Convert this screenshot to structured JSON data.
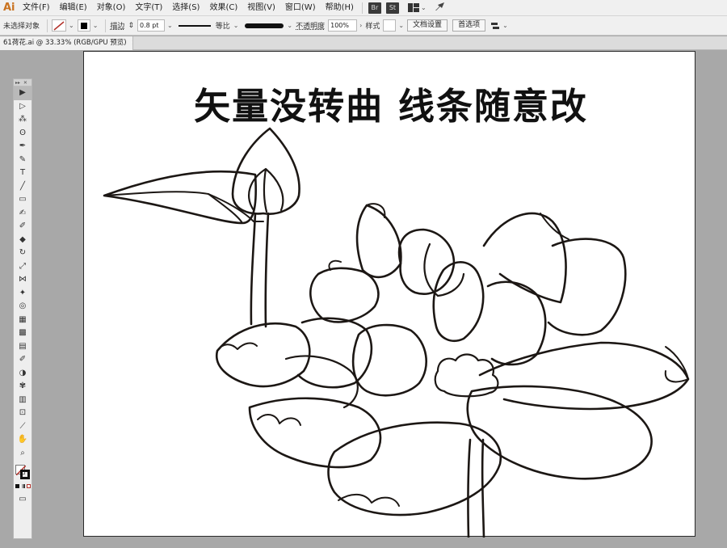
{
  "app": {
    "logo": "Ai"
  },
  "menu": {
    "items": [
      "文件(F)",
      "编辑(E)",
      "对象(O)",
      "文字(T)",
      "选择(S)",
      "效果(C)",
      "视图(V)",
      "窗口(W)",
      "帮助(H)"
    ],
    "badges": [
      "Br",
      "St"
    ]
  },
  "control_bar": {
    "selection_status": "未选择对象",
    "stroke_label": "描边",
    "stroke_weight": "0.8 pt",
    "profile_label": "等比",
    "opacity_label": "不透明度",
    "opacity_value": "100%",
    "style_label": "样式",
    "doc_setup_button": "文档设置",
    "preferences_button": "首选项",
    "colors": {
      "stroke_swatch": "#b3322b",
      "fill_swatch": "#000000"
    }
  },
  "document_tab": {
    "title": "61荷花.ai @ 33.33% (RGB/GPU 预览)",
    "close": "×"
  },
  "artwork": {
    "overlay_text": "矢量没转曲  线条随意改"
  },
  "tools": [
    "selection-tool",
    "direct-selection-tool",
    "magic-wand-tool",
    "lasso-tool",
    "pen-tool",
    "curvature-tool",
    "type-tool",
    "line-segment-tool",
    "rectangle-tool",
    "paintbrush-tool",
    "shaper-tool",
    "eraser-tool",
    "rotate-tool",
    "scale-tool",
    "width-tool",
    "puppet-warp-tool",
    "shape-builder-tool",
    "perspective-grid-tool",
    "mesh-tool",
    "gradient-tool",
    "eyedropper-tool",
    "blend-tool",
    "symbol-sprayer-tool",
    "column-graph-tool",
    "artboard-tool",
    "slice-tool",
    "hand-tool",
    "zoom-tool"
  ]
}
